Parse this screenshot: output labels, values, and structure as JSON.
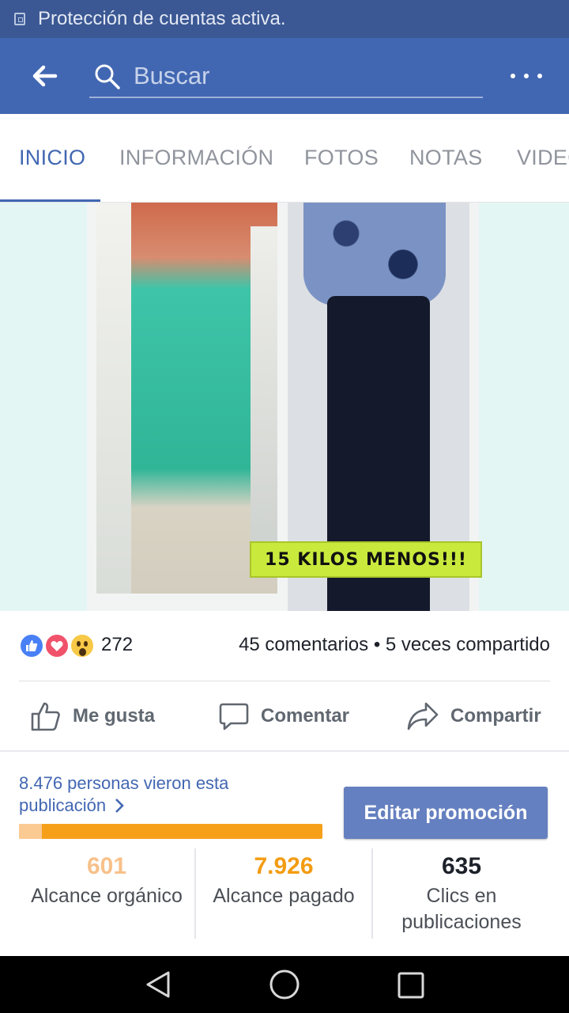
{
  "status_bar": {
    "text": "Protección de cuentas activa."
  },
  "search": {
    "placeholder": "Buscar"
  },
  "tabs": [
    {
      "label": "INICIO",
      "active": true
    },
    {
      "label": "INFORMACIÓN",
      "active": false
    },
    {
      "label": "FOTOS",
      "active": false
    },
    {
      "label": "NOTAS",
      "active": false
    },
    {
      "label": "VIDEOS",
      "active": false
    }
  ],
  "post": {
    "image_caption": "15 KILOS MENOS!!!",
    "reaction_count": "272",
    "comments_shares": "45 comentarios • 5 veces compartido",
    "reactions": [
      "like-icon",
      "love-icon",
      "wow-icon"
    ]
  },
  "actions": {
    "like": "Me gusta",
    "comment": "Comentar",
    "share": "Compartir"
  },
  "insights": {
    "people_saw": "8.476 personas vieron esta publicación",
    "organic_share": 0.076,
    "edit_promotion": "Editar promoción",
    "stats": [
      {
        "value": "601",
        "label": "Alcance orgánico",
        "color": "#f7c18a"
      },
      {
        "value": "7.926",
        "label": "Alcance pagado",
        "color": "#f39c12"
      },
      {
        "value": "635",
        "label": "Clics en publicaciones",
        "color": "#1d2129"
      }
    ]
  },
  "colors": {
    "brand": "#4267b2",
    "status_bar": "#3b5894",
    "link": "#4267b2"
  }
}
